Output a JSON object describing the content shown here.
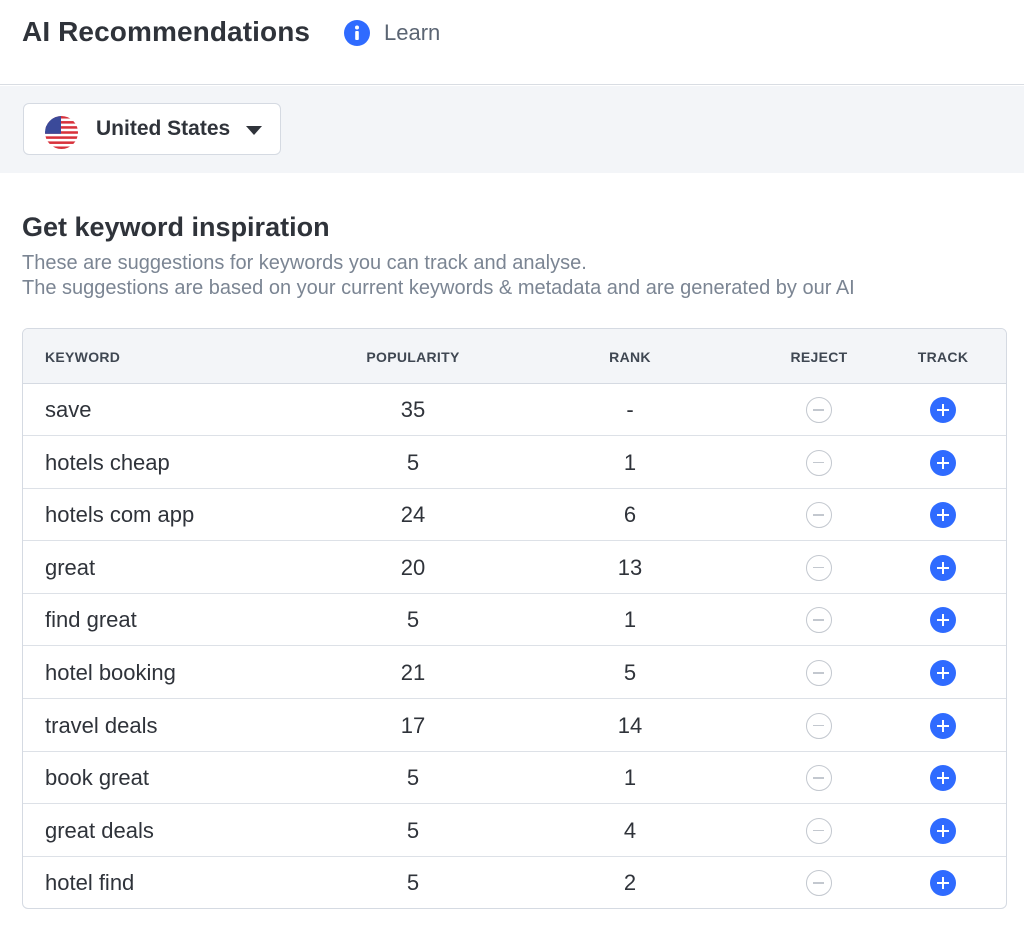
{
  "header": {
    "title": "AI Recommendations",
    "learn_label": "Learn",
    "info_icon": "info-icon"
  },
  "filter": {
    "country": "United States",
    "flag_icon": "us-flag-icon",
    "caret_icon": "caret-down-icon"
  },
  "section": {
    "title": "Get keyword inspiration",
    "description_1": "These are suggestions for keywords you can track and analyse.",
    "description_2": "The suggestions are based on your current keywords & metadata and are generated by our AI"
  },
  "table": {
    "columns": [
      "KEYWORD",
      "POPULARITY",
      "RANK",
      "REJECT",
      "TRACK"
    ],
    "rows": [
      {
        "keyword": "save",
        "popularity": "35",
        "rank": "-"
      },
      {
        "keyword": "hotels cheap",
        "popularity": "5",
        "rank": "1"
      },
      {
        "keyword": "hotels com app",
        "popularity": "24",
        "rank": "6"
      },
      {
        "keyword": "great",
        "popularity": "20",
        "rank": "13"
      },
      {
        "keyword": "find great",
        "popularity": "5",
        "rank": "1"
      },
      {
        "keyword": "hotel booking",
        "popularity": "21",
        "rank": "5"
      },
      {
        "keyword": "travel deals",
        "popularity": "17",
        "rank": "14"
      },
      {
        "keyword": "book great",
        "popularity": "5",
        "rank": "1"
      },
      {
        "keyword": "great deals",
        "popularity": "5",
        "rank": "4"
      },
      {
        "keyword": "hotel find",
        "popularity": "5",
        "rank": "2"
      }
    ],
    "reject_icon": "minus-circle-icon",
    "track_icon": "plus-circle-icon"
  },
  "colors": {
    "accent": "#2f6bff",
    "muted_text": "#7b8593",
    "header_bg": "#f3f5f8"
  }
}
